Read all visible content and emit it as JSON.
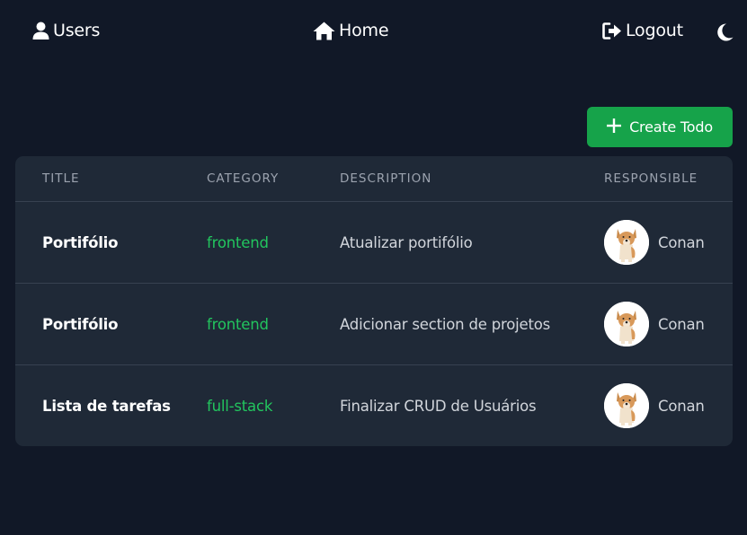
{
  "nav": {
    "users_label": "Users",
    "home_label": "Home",
    "logout_label": "Logout"
  },
  "actions": {
    "create_label": "Create Todo"
  },
  "table": {
    "headers": {
      "title": "Title",
      "category": "Category",
      "description": "Description",
      "responsible": "Responsible"
    },
    "rows": [
      {
        "title": "Portifólio",
        "category": "frontend",
        "description": "Atualizar portifólio",
        "responsible": "Conan"
      },
      {
        "title": "Portifólio",
        "category": "frontend",
        "description": "Adicionar section de projetos",
        "responsible": "Conan"
      },
      {
        "title": "Lista de tarefas",
        "category": "full-stack",
        "description": "Finalizar CRUD de Usuários",
        "responsible": "Conan"
      }
    ]
  },
  "colors": {
    "background": "#111827",
    "surface": "#1f2937",
    "accent_green": "#16a34a",
    "category_green": "#22c55e"
  },
  "icons": [
    "user-icon",
    "home-icon",
    "logout-icon",
    "moon-icon",
    "plus-icon"
  ]
}
